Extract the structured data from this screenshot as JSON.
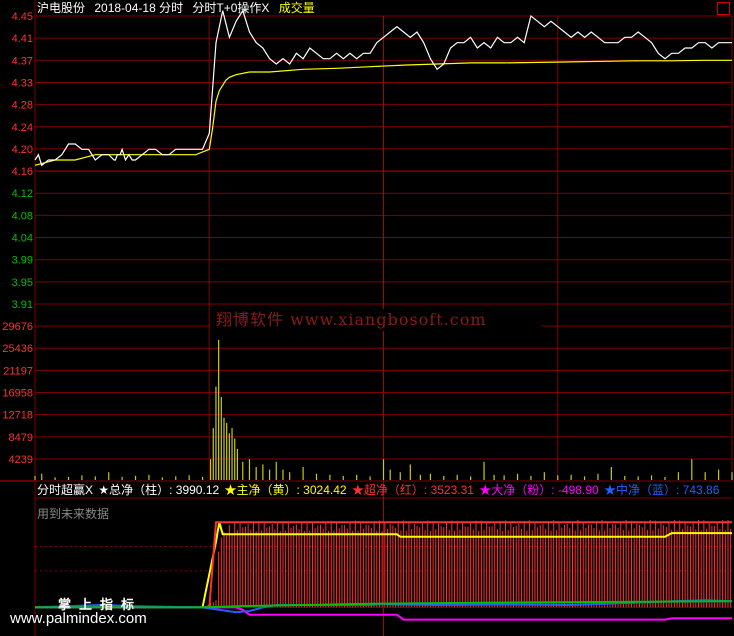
{
  "header": {
    "stock_name": "沪电股份",
    "date_label": "2018-04-18 分时",
    "indicator_name": "分时T+0操作X",
    "volume_label": "成交量"
  },
  "indicator_header": {
    "name": "分时超赢X",
    "items": [
      {
        "label": "★总净（柱）: 3990.12",
        "color": "#ffffff"
      },
      {
        "label": "★主净（黄）: 3024.42",
        "color": "#ffff00"
      },
      {
        "label": "★超净（红）: 3523.31",
        "color": "#ff3030"
      },
      {
        "label": "★大净（粉）: -498.90",
        "color": "#ff00ff"
      },
      {
        "label": "★中净（蓝）: 743.86",
        "color": "#2060ff"
      }
    ],
    "note": "用到未来数据"
  },
  "watermark": "翔博软件 www.xiangbosoft.com",
  "brand_text": "掌上指标",
  "site_text": "www.palmindex.com",
  "colors": {
    "background": "#000000",
    "grid": "#800000",
    "price_axis_up": "#ff3030",
    "price_axis_down": "#00c000",
    "price_line": "#ffffff",
    "avg_line": "#ffff00",
    "volume_bar": "#cccc00"
  },
  "chart_data": [
    {
      "type": "line",
      "title": "分时",
      "ylim": [
        3.91,
        4.45
      ],
      "y_ticks": [
        "4.45",
        "4.41",
        "4.37",
        "4.33",
        "4.28",
        "4.24",
        "4.20",
        "4.16",
        "4.12",
        "4.08",
        "4.04",
        "3.99",
        "3.95",
        "3.91"
      ],
      "prev_close": 4.16,
      "series": [
        {
          "name": "price",
          "x": [
            0,
            5,
            10,
            20,
            30,
            40,
            50,
            60,
            70,
            80,
            90,
            100,
            110,
            118,
            120,
            123,
            127,
            130,
            135,
            140,
            145,
            150,
            160,
            170,
            180,
            190,
            200,
            210,
            220,
            230,
            240,
            250,
            260,
            270,
            280,
            290,
            300,
            310,
            320,
            330,
            340,
            350,
            360,
            370,
            380,
            390,
            400,
            410,
            420,
            430,
            440,
            450,
            460,
            470,
            480,
            490,
            500,
            510,
            520,
            530,
            540,
            550,
            560,
            570,
            580,
            590,
            600,
            610,
            620,
            630,
            640,
            650,
            660,
            670,
            680,
            690,
            700,
            710,
            720,
            730,
            740,
            750,
            760,
            770,
            780,
            790,
            800,
            810,
            820,
            830,
            840,
            850,
            860,
            870,
            880,
            890,
            900,
            910,
            920,
            930,
            940,
            950,
            960,
            970,
            980,
            990,
            1000,
            1010,
            1020,
            1030,
            1040
          ],
          "values": [
            4.18,
            4.19,
            4.17,
            4.18,
            4.18,
            4.19,
            4.21,
            4.21,
            4.2,
            4.2,
            4.18,
            4.19,
            4.19,
            4.18,
            4.18,
            4.19,
            4.19,
            4.2,
            4.18,
            4.19,
            4.18,
            4.18,
            4.19,
            4.2,
            4.2,
            4.19,
            4.19,
            4.2,
            4.2,
            4.2,
            4.2,
            4.2,
            4.23,
            4.4,
            4.46,
            4.41,
            4.44,
            4.46,
            4.42,
            4.4,
            4.39,
            4.37,
            4.36,
            4.37,
            4.36,
            4.38,
            4.37,
            4.39,
            4.38,
            4.37,
            4.37,
            4.38,
            4.37,
            4.38,
            4.37,
            4.38,
            4.38,
            4.4,
            4.41,
            4.42,
            4.43,
            4.42,
            4.41,
            4.42,
            4.4,
            4.37,
            4.35,
            4.36,
            4.39,
            4.4,
            4.4,
            4.41,
            4.39,
            4.4,
            4.39,
            4.41,
            4.4,
            4.4,
            4.41,
            4.4,
            4.45,
            4.44,
            4.43,
            4.44,
            4.43,
            4.42,
            4.41,
            4.42,
            4.41,
            4.42,
            4.41,
            4.4,
            4.4,
            4.4,
            4.41,
            4.41,
            4.42,
            4.41,
            4.4,
            4.38,
            4.37,
            4.38,
            4.38,
            4.39,
            4.39,
            4.4,
            4.4,
            4.39,
            4.4,
            4.4,
            4.4
          ]
        },
        {
          "name": "avg",
          "x": [
            0,
            30,
            60,
            90,
            120,
            150,
            180,
            210,
            240,
            260,
            265,
            270,
            275,
            280,
            285,
            290,
            300,
            320,
            350,
            400,
            450,
            500,
            550,
            600,
            650,
            700,
            750,
            800,
            850,
            900,
            950,
            1000,
            1040
          ],
          "values": [
            4.17,
            4.18,
            4.18,
            4.19,
            4.19,
            4.19,
            4.19,
            4.19,
            4.19,
            4.2,
            4.24,
            4.29,
            4.31,
            4.32,
            4.33,
            4.335,
            4.34,
            4.345,
            4.345,
            4.35,
            4.352,
            4.355,
            4.358,
            4.36,
            4.362,
            4.362,
            4.363,
            4.364,
            4.365,
            4.366,
            4.366,
            4.367,
            4.367
          ]
        }
      ]
    },
    {
      "type": "bar",
      "title": "成交量",
      "ylim": [
        0,
        29676
      ],
      "y_ticks": [
        "29676",
        "25436",
        "21197",
        "16958",
        "12718",
        "8479",
        "4239"
      ],
      "x_range": [
        0,
        1040
      ],
      "volume": [
        {
          "x": 0,
          "v": 800
        },
        {
          "x": 10,
          "v": 1200
        },
        {
          "x": 30,
          "v": 500
        },
        {
          "x": 50,
          "v": 600
        },
        {
          "x": 70,
          "v": 900
        },
        {
          "x": 90,
          "v": 700
        },
        {
          "x": 110,
          "v": 1500
        },
        {
          "x": 130,
          "v": 600
        },
        {
          "x": 150,
          "v": 800
        },
        {
          "x": 170,
          "v": 1000
        },
        {
          "x": 190,
          "v": 500
        },
        {
          "x": 210,
          "v": 700
        },
        {
          "x": 230,
          "v": 900
        },
        {
          "x": 250,
          "v": 600
        },
        {
          "x": 262,
          "v": 4000
        },
        {
          "x": 266,
          "v": 10000
        },
        {
          "x": 270,
          "v": 18000
        },
        {
          "x": 274,
          "v": 27000
        },
        {
          "x": 278,
          "v": 16000
        },
        {
          "x": 282,
          "v": 12000
        },
        {
          "x": 286,
          "v": 11000
        },
        {
          "x": 290,
          "v": 9000
        },
        {
          "x": 294,
          "v": 10000
        },
        {
          "x": 298,
          "v": 8000
        },
        {
          "x": 302,
          "v": 6000
        },
        {
          "x": 310,
          "v": 3500
        },
        {
          "x": 320,
          "v": 4000
        },
        {
          "x": 330,
          "v": 2500
        },
        {
          "x": 340,
          "v": 3000
        },
        {
          "x": 350,
          "v": 2000
        },
        {
          "x": 360,
          "v": 3500
        },
        {
          "x": 370,
          "v": 2000
        },
        {
          "x": 380,
          "v": 1500
        },
        {
          "x": 400,
          "v": 2500
        },
        {
          "x": 420,
          "v": 1200
        },
        {
          "x": 440,
          "v": 1000
        },
        {
          "x": 460,
          "v": 800
        },
        {
          "x": 480,
          "v": 1000
        },
        {
          "x": 500,
          "v": 700
        },
        {
          "x": 520,
          "v": 4000
        },
        {
          "x": 530,
          "v": 2000
        },
        {
          "x": 545,
          "v": 1500
        },
        {
          "x": 560,
          "v": 3000
        },
        {
          "x": 575,
          "v": 1000
        },
        {
          "x": 590,
          "v": 1200
        },
        {
          "x": 610,
          "v": 800
        },
        {
          "x": 630,
          "v": 1000
        },
        {
          "x": 650,
          "v": 700
        },
        {
          "x": 670,
          "v": 3500
        },
        {
          "x": 685,
          "v": 1000
        },
        {
          "x": 700,
          "v": 900
        },
        {
          "x": 720,
          "v": 1200
        },
        {
          "x": 740,
          "v": 800
        },
        {
          "x": 760,
          "v": 1500
        },
        {
          "x": 780,
          "v": 900
        },
        {
          "x": 800,
          "v": 1000
        },
        {
          "x": 820,
          "v": 700
        },
        {
          "x": 840,
          "v": 1200
        },
        {
          "x": 860,
          "v": 2500
        },
        {
          "x": 880,
          "v": 800
        },
        {
          "x": 900,
          "v": 700
        },
        {
          "x": 920,
          "v": 900
        },
        {
          "x": 940,
          "v": 600
        },
        {
          "x": 960,
          "v": 1500
        },
        {
          "x": 980,
          "v": 4000
        },
        {
          "x": 1000,
          "v": 1500
        },
        {
          "x": 1020,
          "v": 2000
        },
        {
          "x": 1040,
          "v": 1500
        }
      ]
    },
    {
      "type": "bar",
      "title": "分时超赢X",
      "x_range": [
        0,
        1040
      ],
      "series": [
        {
          "name": "总净（柱）",
          "x": [
            0,
            250,
            270,
            275,
            290,
            300,
            1040
          ],
          "values": [
            0,
            0,
            300,
            3000,
            3400,
            3550,
            3600
          ]
        },
        {
          "name": "主净（黄）",
          "x": [
            0,
            250,
            270,
            275,
            280,
            540,
            545,
            940,
            950,
            1040
          ],
          "values": [
            0,
            0,
            2700,
            3500,
            3000,
            3000,
            2900,
            2900,
            3050,
            3050
          ]
        },
        {
          "name": "超净（红）",
          "x": [
            0,
            260,
            270,
            1040
          ],
          "values": [
            0,
            0,
            3500,
            3500
          ]
        },
        {
          "name": "大净（粉）",
          "x": [
            0,
            300,
            310,
            320,
            540,
            550,
            940,
            950,
            1040
          ],
          "values": [
            0,
            0,
            -100,
            -300,
            -300,
            -500,
            -500,
            -450,
            -450
          ]
        },
        {
          "name": "中净（蓝）",
          "x": [
            0,
            100,
            150,
            250,
            300,
            320,
            340,
            360,
            500,
            520,
            540,
            600,
            700,
            800,
            1000,
            1040
          ],
          "values": [
            0,
            100,
            50,
            0,
            -200,
            -150,
            0,
            100,
            100,
            150,
            120,
            100,
            120,
            100,
            300,
            250
          ]
        },
        {
          "name": "green",
          "x": [
            0,
            250,
            300,
            400,
            500,
            700,
            1040
          ],
          "values": [
            0,
            0,
            50,
            100,
            150,
            200,
            250
          ]
        }
      ]
    }
  ]
}
